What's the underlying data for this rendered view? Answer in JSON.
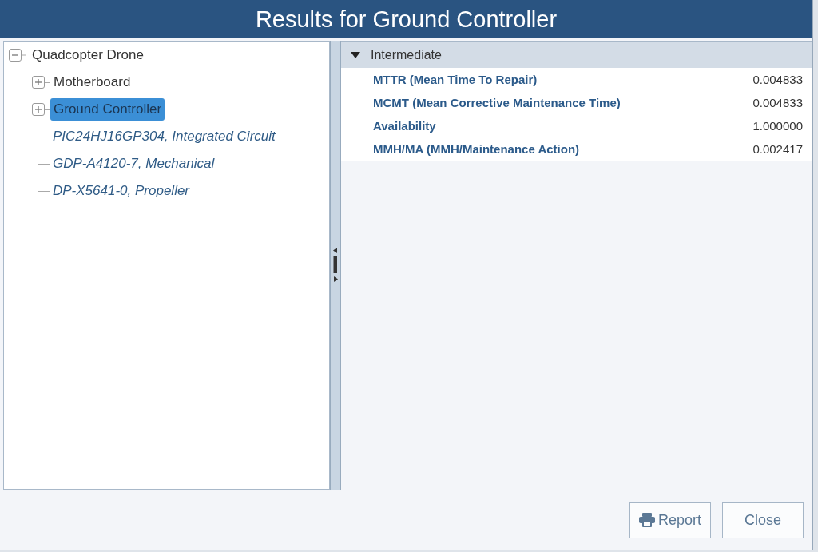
{
  "dialog": {
    "title": "Results for Ground Controller"
  },
  "tree": {
    "label": "Quadcopter Drone",
    "kind": "assembly",
    "expanded": true,
    "selected": false,
    "children": [
      {
        "label": "Motherboard",
        "kind": "assembly",
        "expanded": false,
        "selected": false
      },
      {
        "label": "Ground Controller",
        "kind": "assembly",
        "expanded": false,
        "selected": true
      },
      {
        "label": "PIC24HJ16GP304, Integrated Circuit",
        "kind": "part",
        "selected": false
      },
      {
        "label": "GDP-A4120-7, Mechanical",
        "kind": "part",
        "selected": false
      },
      {
        "label": "DP-X5641-0, Propeller",
        "kind": "part",
        "selected": false
      }
    ]
  },
  "results": {
    "section": {
      "title": "Intermediate",
      "expanded": true,
      "rows": [
        {
          "label": "MTTR (Mean Time To Repair)",
          "value": "0.004833"
        },
        {
          "label": "MCMT (Mean Corrective Maintenance Time)",
          "value": "0.004833"
        },
        {
          "label": "Availability",
          "value": "1.000000"
        },
        {
          "label": "MMH/MA (MMH/Maintenance Action)",
          "value": "0.002417"
        }
      ]
    }
  },
  "buttons": [
    {
      "label": "Report",
      "kind": "print"
    },
    {
      "label": "Close",
      "kind": "plain"
    }
  ]
}
